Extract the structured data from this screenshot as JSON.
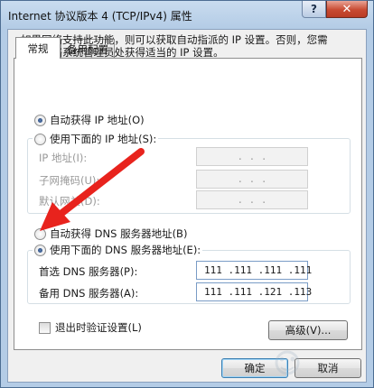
{
  "window": {
    "title": "Internet 协议版本 4 (TCP/IPv4) 属性",
    "help_label": "?",
    "close_label": "✕"
  },
  "tabs": [
    {
      "label": "常规"
    },
    {
      "label": "备用配置"
    }
  ],
  "description": "如果网络支持此功能，则可以获取自动指派的 IP 设置。否则，您需要从网络系统管理员处获得适当的 IP 设置。",
  "ip_section": {
    "auto_label": "自动获得 IP 地址(O)",
    "manual_label": "使用下面的 IP 地址(S):",
    "selected": "auto",
    "fields": [
      {
        "label": "IP 地址(I):",
        "dots": ". . ."
      },
      {
        "label": "子网掩码(U):",
        "dots": ". . ."
      },
      {
        "label": "默认网关(D):",
        "dots": ". . ."
      }
    ]
  },
  "dns_section": {
    "auto_label": "自动获得 DNS 服务器地址(B)",
    "manual_label": "使用下面的 DNS 服务器地址(E):",
    "selected": "manual",
    "preferred": {
      "label": "首选 DNS 服务器(P):",
      "value": "111 .111 .111 .111"
    },
    "alternate": {
      "label": "备用 DNS 服务器(A):",
      "value": "111 .111 .121 .113"
    }
  },
  "validate_checkbox": {
    "label": "退出时验证设置(L)",
    "checked": false
  },
  "buttons": {
    "advanced": "高级(V)...",
    "ok": "确定",
    "cancel": "取消"
  },
  "annotation": {
    "arrow_color": "#e8231d"
  }
}
